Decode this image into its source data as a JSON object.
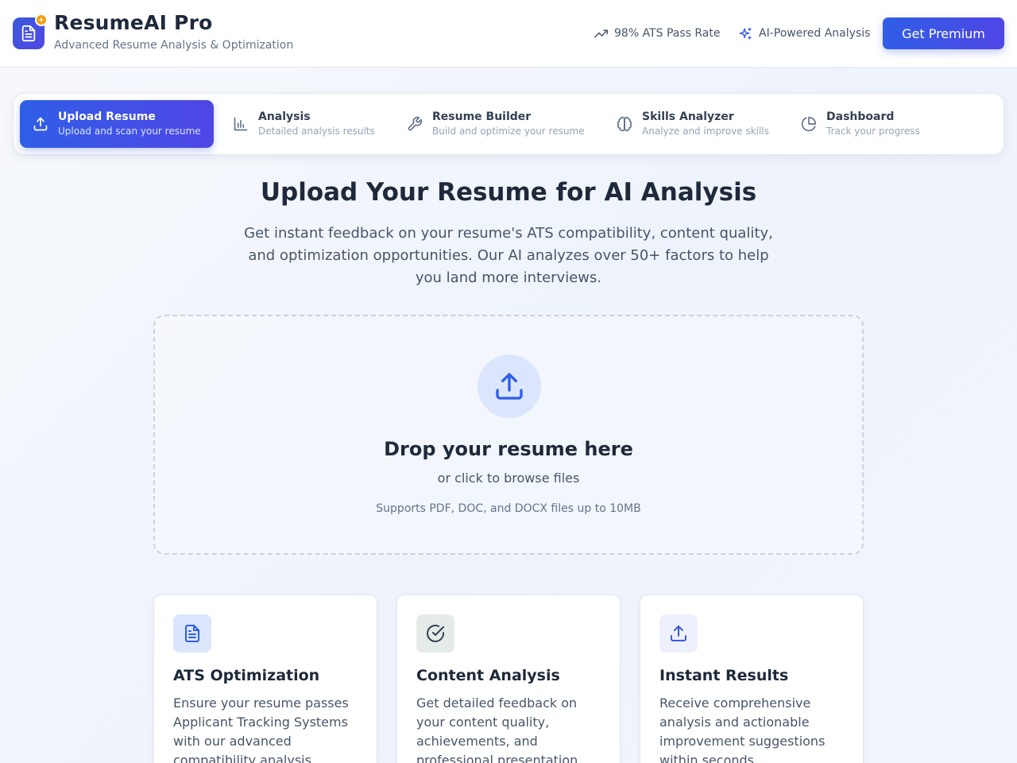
{
  "header": {
    "title": "ResumeAI Pro",
    "subtitle": "Advanced Resume Analysis & Optimization",
    "stats": [
      {
        "icon": "trending-up-icon",
        "label": "98% ATS Pass Rate"
      },
      {
        "icon": "sparkles-icon",
        "label": "AI-Powered Analysis"
      }
    ],
    "premium_label": "Get Premium"
  },
  "nav": {
    "items": [
      {
        "icon": "upload-icon",
        "title": "Upload Resume",
        "desc": "Upload and scan your resume",
        "active": true
      },
      {
        "icon": "bar-chart-icon",
        "title": "Analysis",
        "desc": "Detailed analysis results",
        "active": false
      },
      {
        "icon": "wrench-icon",
        "title": "Resume Builder",
        "desc": "Build and optimize your resume",
        "active": false
      },
      {
        "icon": "brain-icon",
        "title": "Skills Analyzer",
        "desc": "Analyze and improve skills",
        "active": false
      },
      {
        "icon": "pie-chart-icon",
        "title": "Dashboard",
        "desc": "Track your progress",
        "active": false
      }
    ]
  },
  "main": {
    "title": "Upload Your Resume for AI Analysis",
    "description": "Get instant feedback on your resume's ATS compatibility, content quality, and optimization opportunities. Our AI analyzes over 50+ factors to help you land more interviews."
  },
  "dropzone": {
    "title": "Drop your resume here",
    "subtitle": "or click to browse files",
    "note": "Supports PDF, DOC, and DOCX files up to 10MB"
  },
  "features": [
    {
      "icon": "document-icon",
      "title": "ATS Optimization",
      "desc": "Ensure your resume passes Applicant Tracking Systems with our advanced compatibility analysis."
    },
    {
      "icon": "check-circle-icon",
      "title": "Content Analysis",
      "desc": "Get detailed feedback on your content quality, achievements, and professional presentation."
    },
    {
      "icon": "upload-icon",
      "title": "Instant Results",
      "desc": "Receive comprehensive analysis and actionable improvement suggestions within seconds."
    }
  ],
  "colors": {
    "accent": "#3b5bdb",
    "accent_end": "#4f46e5",
    "badge": "#f59e0b"
  }
}
